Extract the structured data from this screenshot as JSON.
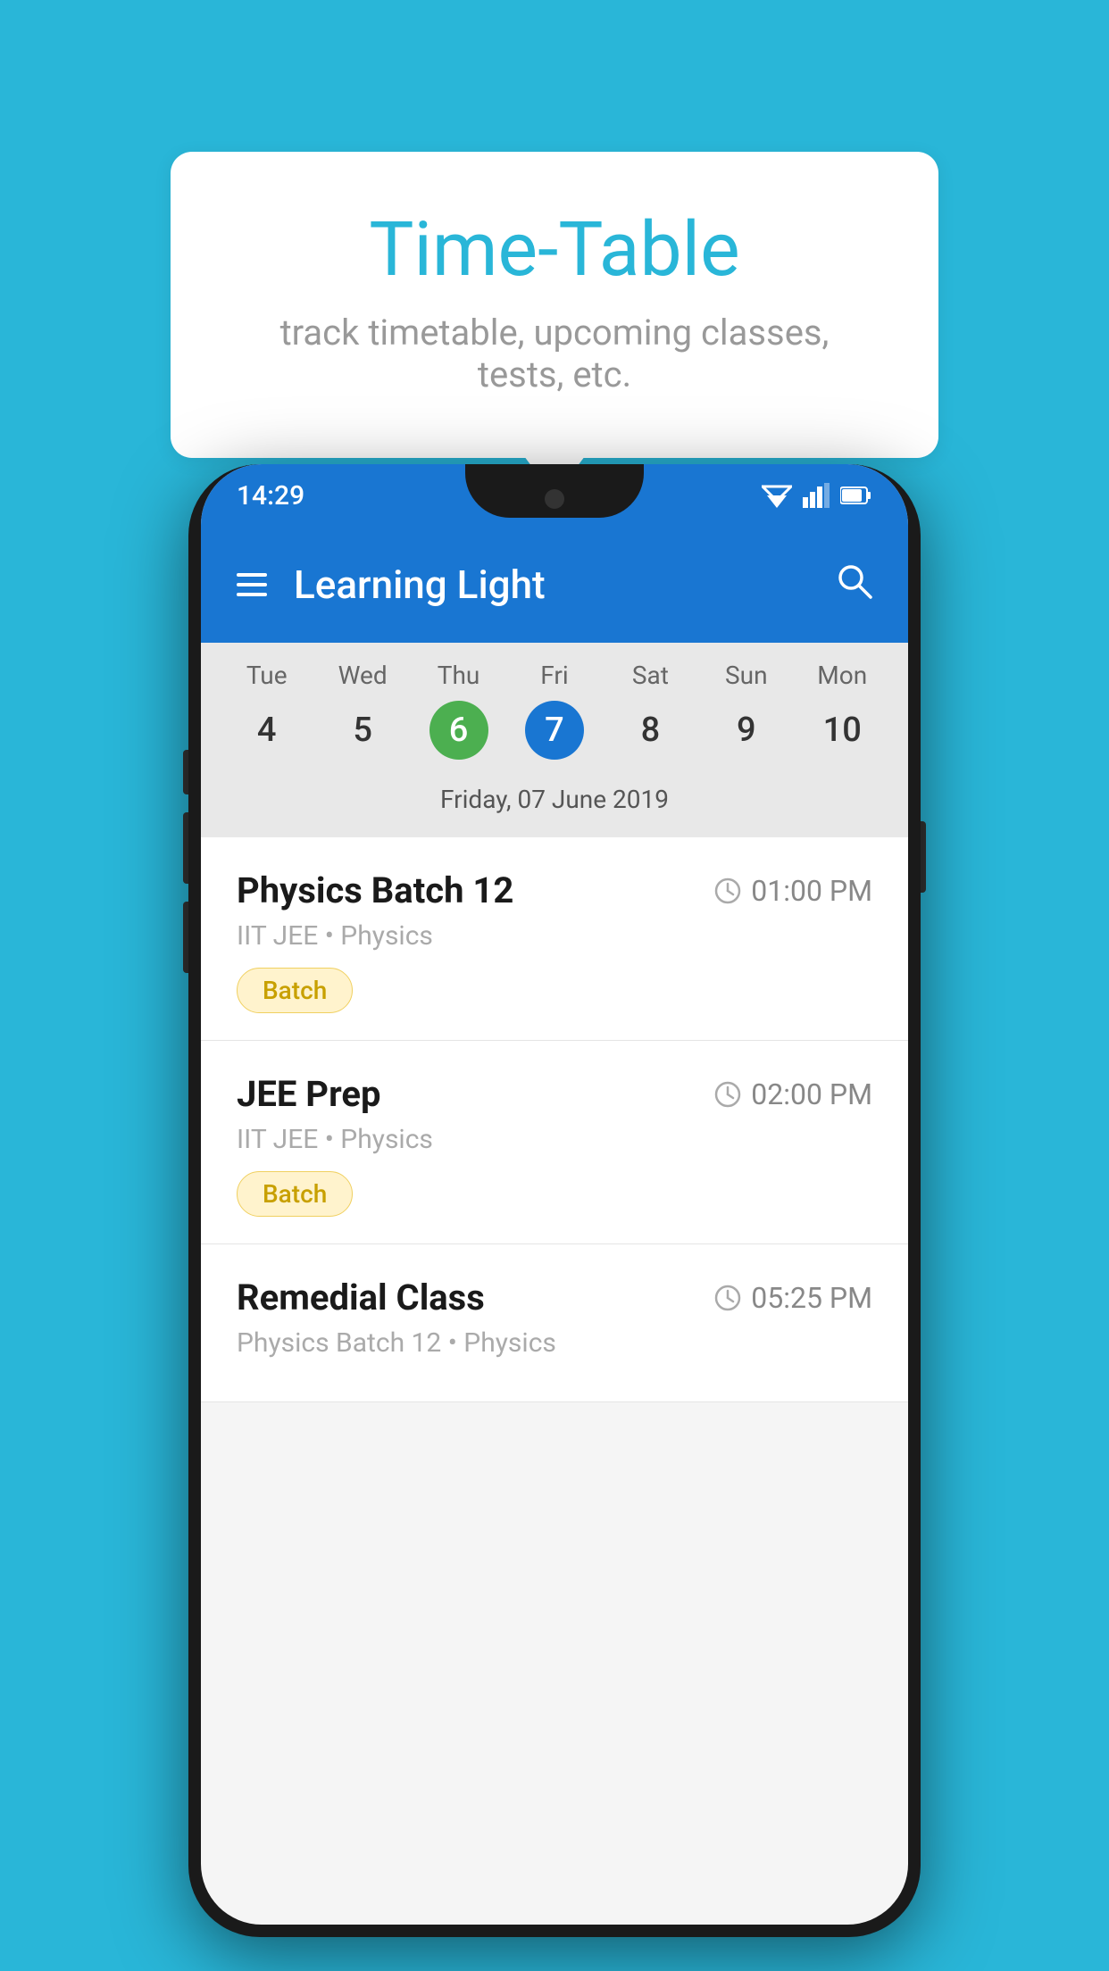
{
  "background_color": "#29B6D8",
  "tooltip_card": {
    "title": "Time-Table",
    "subtitle": "track timetable, upcoming classes, tests, etc."
  },
  "status_bar": {
    "time": "14:29"
  },
  "app_header": {
    "title": "Learning Light"
  },
  "calendar": {
    "days": [
      {
        "name": "Tue",
        "num": "4",
        "state": "normal"
      },
      {
        "name": "Wed",
        "num": "5",
        "state": "normal"
      },
      {
        "name": "Thu",
        "num": "6",
        "state": "today"
      },
      {
        "name": "Fri",
        "num": "7",
        "state": "selected"
      },
      {
        "name": "Sat",
        "num": "8",
        "state": "normal"
      },
      {
        "name": "Sun",
        "num": "9",
        "state": "normal"
      },
      {
        "name": "Mon",
        "num": "10",
        "state": "normal"
      }
    ],
    "selected_date_label": "Friday, 07 June 2019"
  },
  "schedule_items": [
    {
      "name": "Physics Batch 12",
      "time": "01:00 PM",
      "course": "IIT JEE • Physics",
      "tag": "Batch"
    },
    {
      "name": "JEE Prep",
      "time": "02:00 PM",
      "course": "IIT JEE • Physics",
      "tag": "Batch"
    },
    {
      "name": "Remedial Class",
      "time": "05:25 PM",
      "course": "Physics Batch 12 • Physics",
      "tag": null
    }
  ]
}
